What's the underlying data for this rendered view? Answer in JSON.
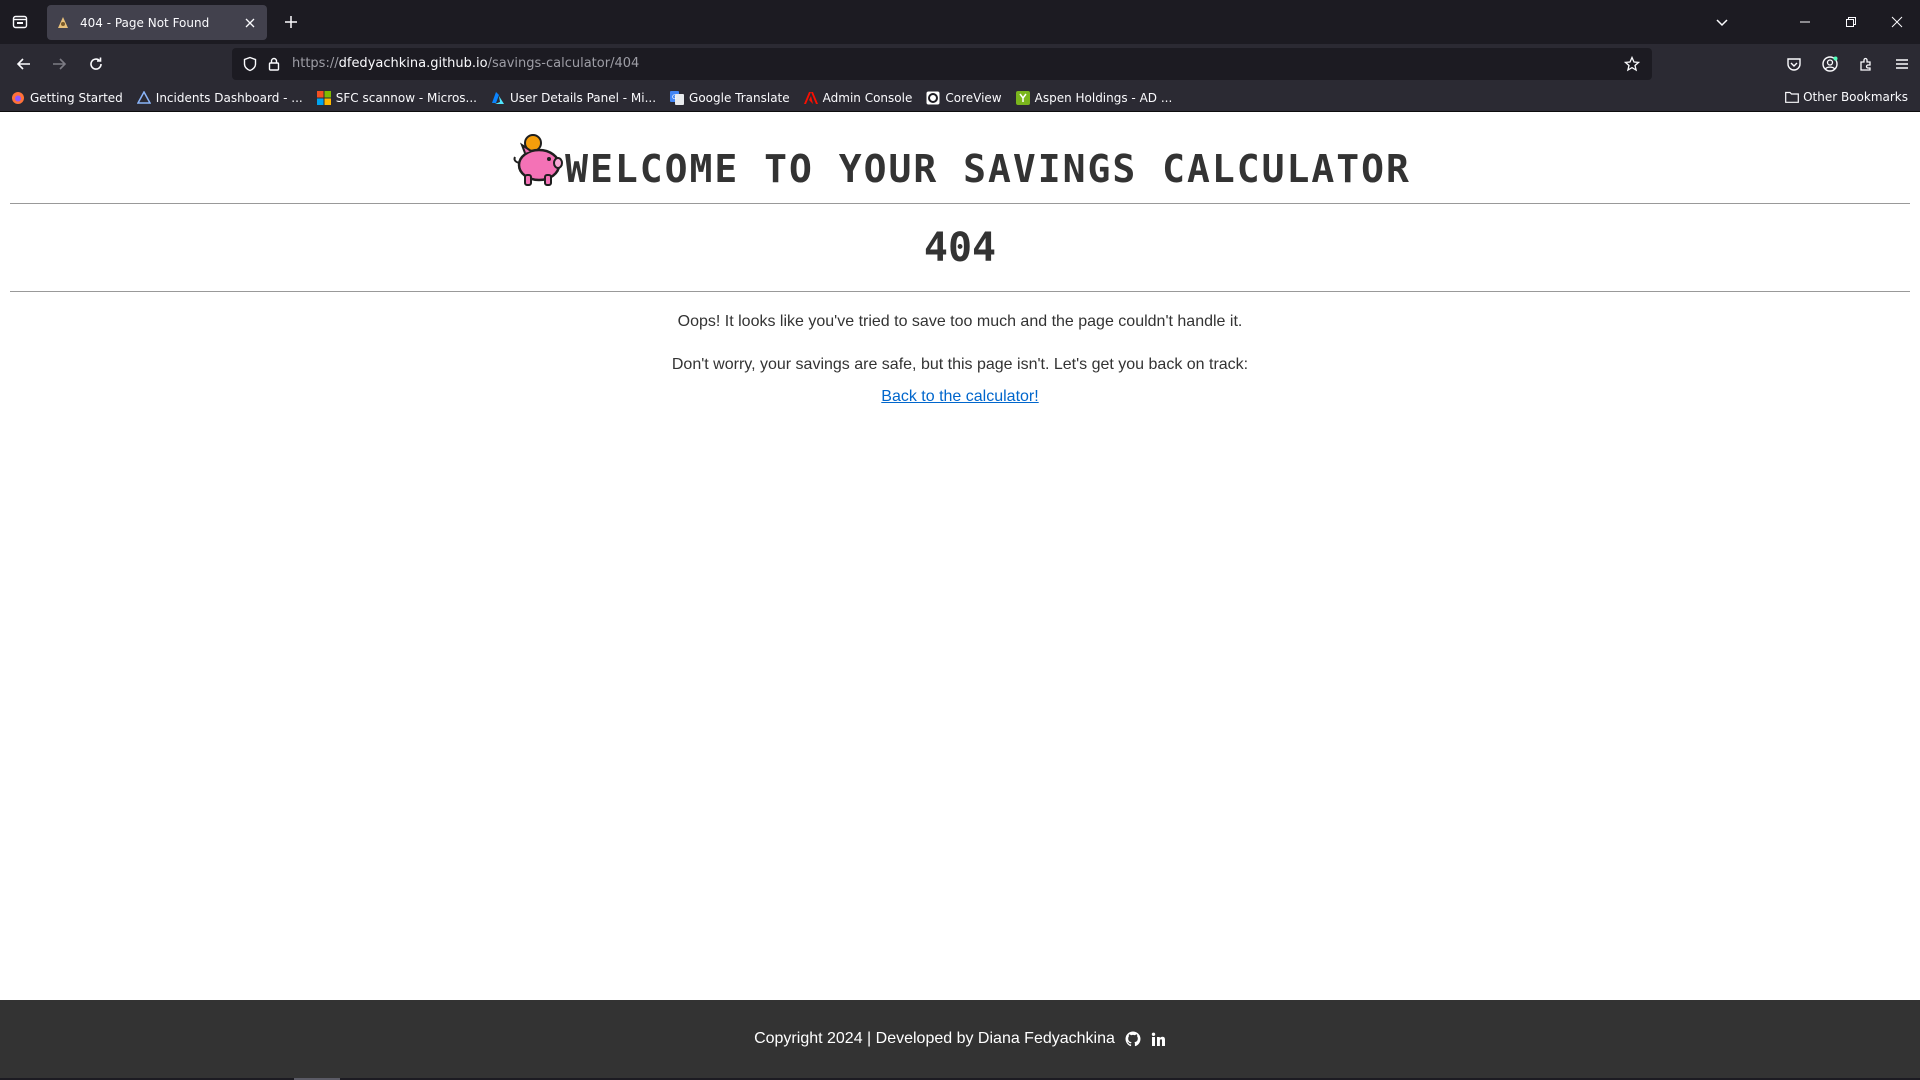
{
  "browser": {
    "tab": {
      "title": "404 - Page Not Found"
    },
    "url": {
      "prefix": "https://",
      "host": "dfedyachkina.github.io",
      "path": "/savings-calculator/404"
    },
    "bookmarks": [
      {
        "label": "Getting Started",
        "icon": "firefox-icon",
        "color": "#ff7139"
      },
      {
        "label": "Incidents Dashboard - ...",
        "icon": "incidents-icon",
        "color": "#8ab4f8"
      },
      {
        "label": "SFC scannow - Micros...",
        "icon": "microsoft-icon",
        "color": "#f25022"
      },
      {
        "label": "User Details Panel - Mi...",
        "icon": "azure-icon",
        "color": "#0a84ff"
      },
      {
        "label": "Google Translate",
        "icon": "translate-icon",
        "color": "#4285f4"
      },
      {
        "label": "Admin Console",
        "icon": "adobe-icon",
        "color": "#fa0f00"
      },
      {
        "label": "CoreView",
        "icon": "coreview-icon",
        "color": "#ffffff"
      },
      {
        "label": "Aspen Holdings - AD ...",
        "icon": "aspen-icon",
        "color": "#7ab51d"
      }
    ],
    "other_bookmarks": "Other Bookmarks"
  },
  "page": {
    "heading": "WELCOME TO YOUR SAVINGS CALCULATOR",
    "error_code": "404",
    "message_1": "Oops! It looks like you've tried to save too much and the page couldn't handle it.",
    "message_2": "Don't worry, your savings are safe, but this page isn't. Let's get you back on track:",
    "back_link": "Back to the calculator!",
    "footer_text": "Copyright 2024 | Developed by Diana Fedyachkina"
  },
  "colors": {
    "chrome_dark": "#1c1b22",
    "chrome_mid": "#2b2a33",
    "heading_text": "#333333",
    "link": "#0066cc",
    "footer_bg": "#333333",
    "piggy": "#f472b6",
    "coin": "#f59e0b"
  }
}
